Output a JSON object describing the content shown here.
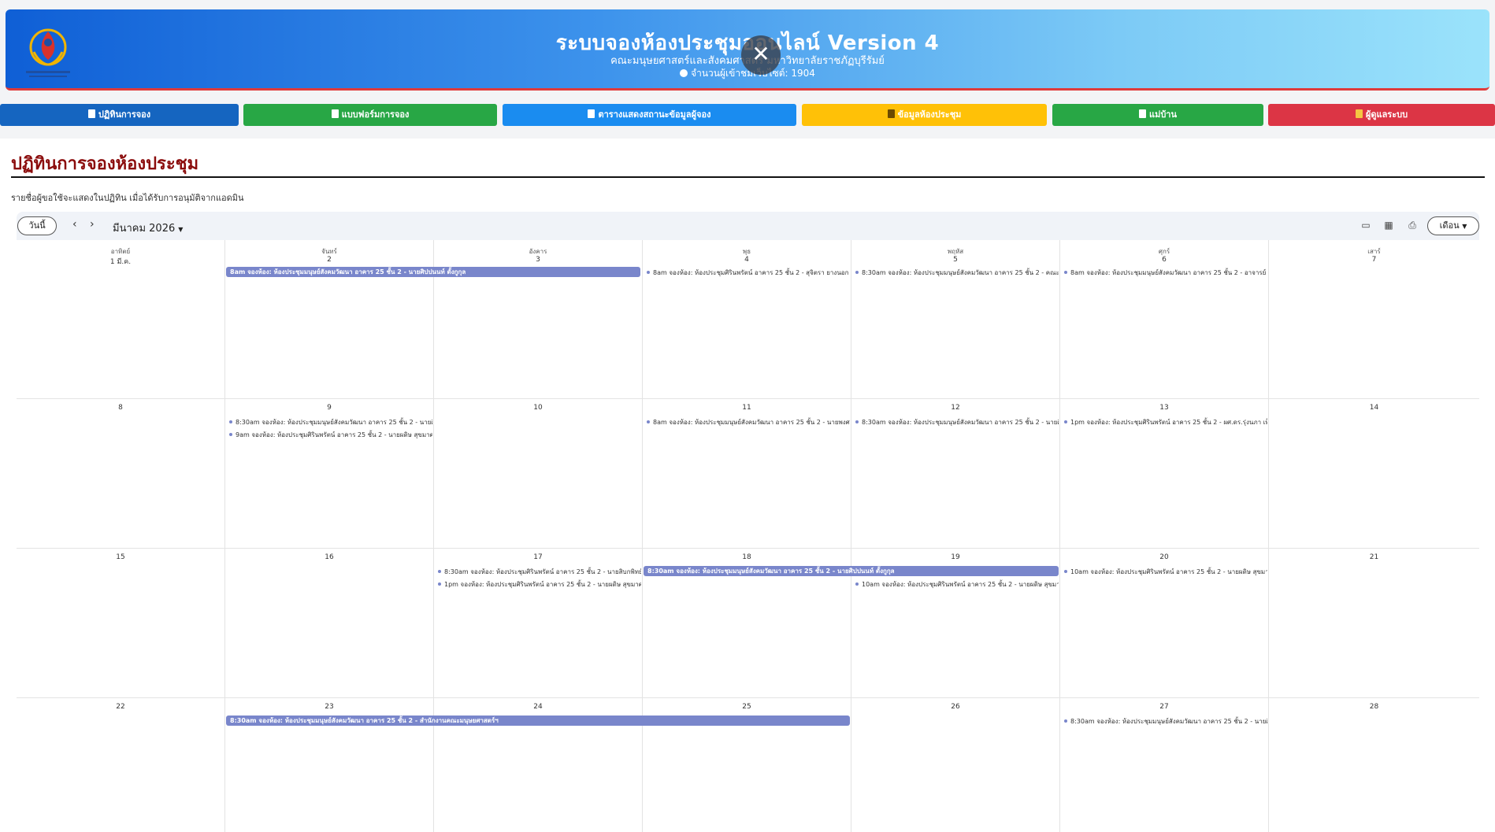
{
  "header": {
    "title": "ระบบจองห้องประชุมออนไลน์ Version 4",
    "subtitle": "คณะมนุษยศาสตร์และสังคมศาสตร์ มหาวิทยาลัยราชภัฏบุรีรัมย์",
    "visitors": "จำนวนผู้เข้าชมเว็บไซต์: 1904"
  },
  "nav": [
    {
      "label": "ปฏิทินการจอง",
      "color": "#1565c0"
    },
    {
      "label": "แบบฟอร์มการจอง",
      "color": "#28a745"
    },
    {
      "label": "ตารางแสดงสถานะข้อมูลผู้จอง",
      "color": "#1a8cf0"
    },
    {
      "label": "ข้อมูลห้องประชุม",
      "color": "#ffc107"
    },
    {
      "label": "แม่บ้าน",
      "color": "#28a745"
    },
    {
      "label": "ผู้ดูแลระบบ",
      "color": "#dc3545"
    }
  ],
  "page": {
    "title": "ปฏิทินการจองห้องประชุม",
    "note": "รายชื่อผู้ขอใช้จะแสดงในปฏิทิน เมื่อได้รับการอนุมัติจากแอดมิน"
  },
  "toolbar": {
    "today": "วันนี้",
    "prev": "‹",
    "next": "›",
    "month": "มีนาคม 2026",
    "view": "เดือน"
  },
  "calendar": {
    "weekdays": [
      "อาทิตย์",
      "จันทร์",
      "อังคาร",
      "พุธ",
      "พฤหัส",
      "ศุกร์",
      "เสาร์"
    ],
    "weeks": [
      [
        "1 มี.ค.",
        "2",
        "3",
        "4",
        "5",
        "6",
        "7"
      ],
      [
        "8",
        "9",
        "10",
        "11",
        "12",
        "13",
        "14"
      ],
      [
        "15",
        "16",
        "17",
        "18",
        "19",
        "20",
        "21"
      ],
      [
        "22",
        "23",
        "24",
        "25",
        "26",
        "27",
        "28"
      ]
    ],
    "events": {
      "w0_bar": "8am จองห้อง: ห้องประชุมมนุษย์สังคมวัฒนา อาคาร 25 ชั้น 2 - นายศิปปนนท์ ตั้งกูกุล",
      "w0_wed": "8am จองห้อง: ห้องประชุมศิรินพรัตน์ อาคาร 25 ชั้น 2 - สุจิตรา ยางนอก",
      "w0_thu": "8:30am จองห้อง: ห้องประชุมมนุษย์สังคมวัฒนา อาคาร 25 ชั้น 2 - คณะพยาบ",
      "w0_fri": "8am จองห้อง: ห้องประชุมมนุษย์สังคมวัฒนา อาคาร 25 ชั้น 2 - อาจารย์ ดร.ชัน",
      "w1_mon1": "8:30am จองห้อง: ห้องประชุมมนุษย์สังคมวัฒนา อาคาร 25 ชั้น 2 - นายศิปปน",
      "w1_mon2": "9am จองห้อง: ห้องประชุมศิรินพรัตน์ อาคาร 25 ชั้น 2 - นายผดิษ สุขมาศ",
      "w1_wed": "8am จองห้อง: ห้องประชุมมนุษย์สังคมวัฒนา อาคาร 25 ชั้น 2 - นายพงศธร ชา",
      "w1_thu": "8:30am จองห้อง: ห้องประชุมมนุษย์สังคมวัฒนา อาคาร 25 ชั้น 2 - นายศิปปน",
      "w1_fri": "1pm จองห้อง: ห้องประชุมศิรินพรัตน์ อาคาร 25 ชั้น 2 - ผศ.ดร.รุ่งนภา เพ็มดี",
      "w2_tue1": "8:30am จองห้อง: ห้องประชุมศิรินพรัตน์ อาคาร 25 ชั้น 2 - นายสิบกพิทย์",
      "w2_tue2": "1pm จองห้อง: ห้องประชุมศิรินพรัตน์ อาคาร 25 ชั้น 2 - นายผดิษ สุขมาศ",
      "w2_bar": "8:30am จองห้อง: ห้องประชุมมนุษย์สังคมวัฒนา อาคาร 25 ชั้น 2 - นายศิปปนนท์ ตั้งกูกุล",
      "w2_thu": "10am จองห้อง: ห้องประชุมศิรินพรัตน์ อาคาร 25 ชั้น 2 - นายผดิษ สุขมาศ",
      "w2_fri": "10am จองห้อง: ห้องประชุมศิรินพรัตน์ อาคาร 25 ชั้น 2 - นายผดิษ สุขมาศ",
      "w3_bar": "8:30am จองห้อง: ห้องประชุมมนุษย์สังคมวัฒนา อาคาร 25 ชั้น 2 - สำนักงานคณะมนุษยศาสตร์ฯ",
      "w3_fri": "8:30am จองห้อง: ห้องประชุมมนุษย์สังคมวัฒนา อาคาร 25 ชั้น 2 - นายศิปปน"
    }
  },
  "colors": {
    "event": "#7986cb",
    "title_red": "#8b0c0c"
  }
}
